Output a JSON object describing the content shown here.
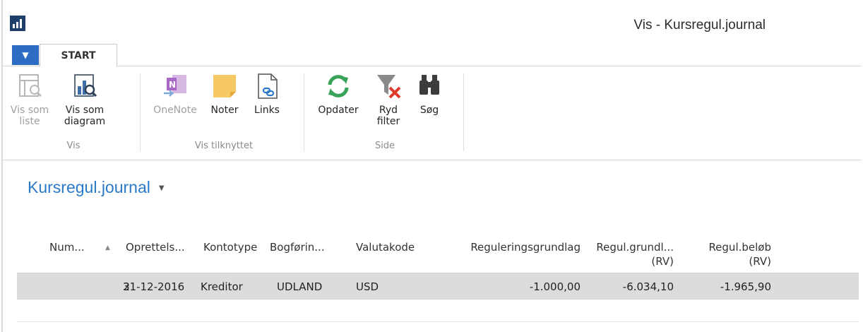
{
  "window": {
    "title": "Vis - Kursregul.journal"
  },
  "ribbon": {
    "file_menu_icon": "caret-down-icon",
    "tab_start": "START",
    "groups": [
      {
        "label": "Vis",
        "buttons": [
          {
            "label_1": "Vis som",
            "label_2": "liste",
            "icon": "list-view-icon",
            "enabled": false
          },
          {
            "label_1": "Vis som",
            "label_2": "diagram",
            "icon": "chart-view-icon",
            "enabled": true
          }
        ]
      },
      {
        "label": "Vis tilknyttet",
        "buttons": [
          {
            "label_1": "OneNote",
            "icon": "onenote-icon",
            "enabled": false
          },
          {
            "label_1": "Noter",
            "icon": "note-icon",
            "enabled": true
          },
          {
            "label_1": "Links",
            "icon": "link-document-icon",
            "enabled": true
          }
        ]
      },
      {
        "label": "Side",
        "buttons": [
          {
            "label_1": "Opdater",
            "icon": "refresh-icon",
            "enabled": true
          },
          {
            "label_1": "Ryd",
            "label_2": "filter",
            "icon": "clear-filter-icon",
            "enabled": true
          },
          {
            "label_1": "Søg",
            "icon": "binoculars-icon",
            "enabled": true
          }
        ]
      }
    ]
  },
  "page": {
    "title": "Kursregul.journal",
    "title_menu_icon": "small-caret-down-icon"
  },
  "table": {
    "columns": [
      {
        "label": "Num..."
      },
      {
        "label": "Oprettels..."
      },
      {
        "label": "Kontotype"
      },
      {
        "label": "Bogførin..."
      },
      {
        "label": "Valutakode"
      },
      {
        "label": "Reguleringsgrundlag"
      },
      {
        "label_1": "Regul.grundl...",
        "label_2": "(RV)"
      },
      {
        "label_1": "Regul.beløb",
        "label_2": "(RV)"
      }
    ],
    "rows": [
      {
        "num": "2",
        "date": "31-12-2016",
        "account_type": "Kreditor",
        "posting": "UDLAND",
        "currency": "USD",
        "base": "-1.000,00",
        "base_lcy": "-6.034,10",
        "amount_lcy": "-1.965,90"
      }
    ]
  },
  "colors": {
    "accent": "#2b79c9",
    "file_button": "#2d6cc4",
    "selected_row": "#dcdcdc"
  }
}
